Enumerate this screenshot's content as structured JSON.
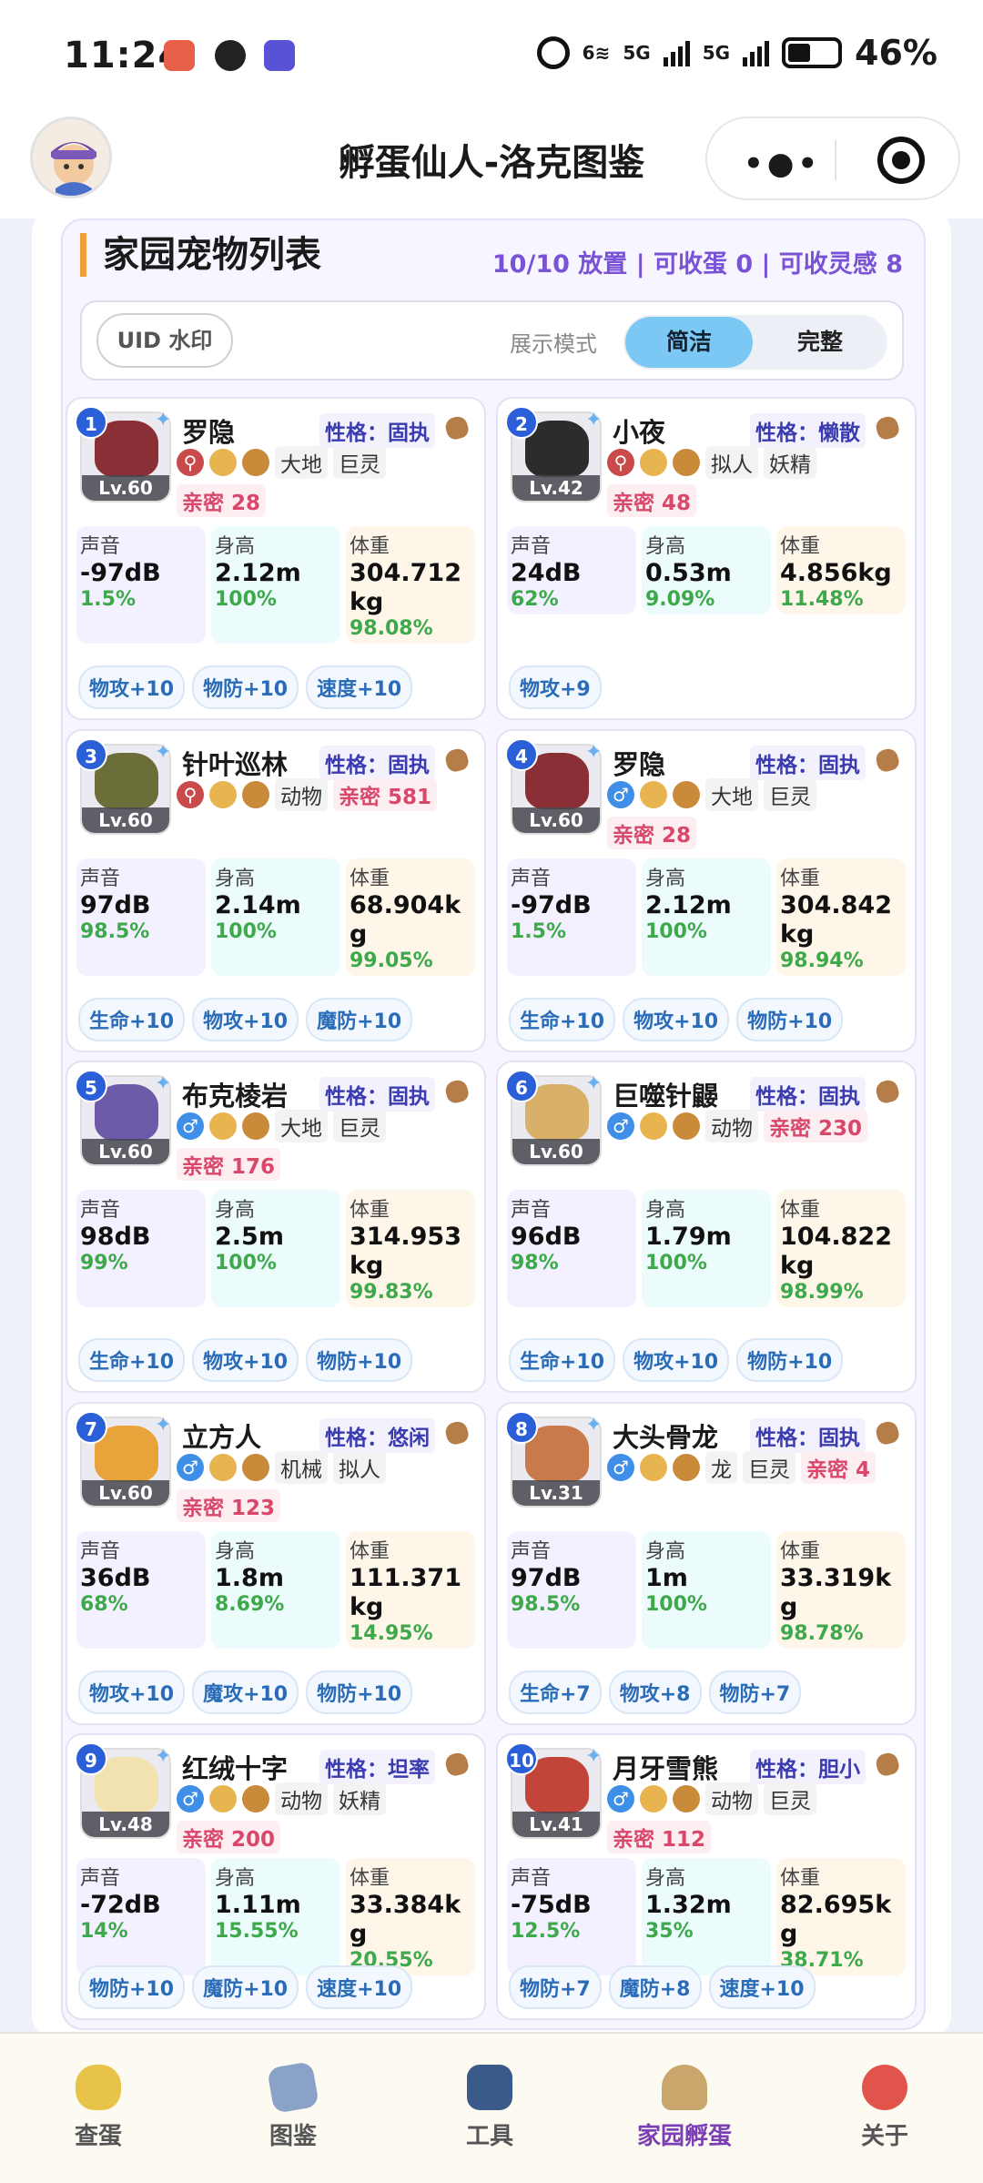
{
  "status_bar": {
    "time": "11:24",
    "network_a": "6",
    "network_b": "5G",
    "network_c": "5G",
    "battery": "46%"
  },
  "header": {
    "title": "孵蛋仙人-洛克图鉴",
    "more_icon": "more-dots-icon",
    "close_icon": "target-icon"
  },
  "section": {
    "title": "家园宠物列表",
    "stats": "10/10 放置 | 可收蛋 0 | 可收灵感 8",
    "uid_button": "UID 水印",
    "mode_label": "展示模式",
    "mode_simple": "简洁",
    "mode_full": "完整"
  },
  "labels": {
    "voice": "声音",
    "height": "身高",
    "weight": "体重"
  },
  "pets": [
    {
      "num": "1",
      "name": "罗隐",
      "level": "Lv.60",
      "nature": "性格：固执",
      "gender": "none",
      "tags": [
        "大地",
        "巨灵"
      ],
      "affinity": "亲密 28",
      "voice": "-97dB",
      "voice_pct": "1.5%",
      "height": "2.12m",
      "height_pct": "100%",
      "weight": "304.712kg",
      "weight_pct": "98.08%",
      "bonuses": [
        "物攻+10",
        "物防+10",
        "速度+10"
      ]
    },
    {
      "num": "2",
      "name": "小夜",
      "level": "Lv.42",
      "nature": "性格：懒散",
      "gender": "none",
      "tags": [
        "拟人",
        "妖精"
      ],
      "affinity": "亲密 48",
      "voice": "24dB",
      "voice_pct": "62%",
      "height": "0.53m",
      "height_pct": "9.09%",
      "weight": "4.856kg",
      "weight_pct": "11.48%",
      "bonuses": [
        "物攻+9"
      ]
    },
    {
      "num": "3",
      "name": "针叶巡林",
      "level": "Lv.60",
      "nature": "性格：固执",
      "gender": "none",
      "tags": [
        "动物"
      ],
      "affinity": "亲密 581",
      "voice": "97dB",
      "voice_pct": "98.5%",
      "height": "2.14m",
      "height_pct": "100%",
      "weight": "68.904kg",
      "weight_pct": "99.05%",
      "bonuses": [
        "生命+10",
        "物攻+10",
        "魔防+10"
      ]
    },
    {
      "num": "4",
      "name": "罗隐",
      "level": "Lv.60",
      "nature": "性格：固执",
      "gender": "male",
      "tags": [
        "大地",
        "巨灵"
      ],
      "affinity": "亲密 28",
      "voice": "-97dB",
      "voice_pct": "1.5%",
      "height": "2.12m",
      "height_pct": "100%",
      "weight": "304.842kg",
      "weight_pct": "98.94%",
      "bonuses": [
        "生命+10",
        "物攻+10",
        "物防+10"
      ]
    },
    {
      "num": "5",
      "name": "布克棱岩",
      "level": "Lv.60",
      "nature": "性格：固执",
      "gender": "male",
      "tags": [
        "大地",
        "巨灵"
      ],
      "affinity": "亲密 176",
      "voice": "98dB",
      "voice_pct": "99%",
      "height": "2.5m",
      "height_pct": "100%",
      "weight": "314.953kg",
      "weight_pct": "99.83%",
      "bonuses": [
        "生命+10",
        "物攻+10",
        "物防+10"
      ]
    },
    {
      "num": "6",
      "name": "巨噬针鼹",
      "level": "Lv.60",
      "nature": "性格：固执",
      "gender": "male",
      "tags": [
        "动物"
      ],
      "affinity": "亲密 230",
      "voice": "96dB",
      "voice_pct": "98%",
      "height": "1.79m",
      "height_pct": "100%",
      "weight": "104.822kg",
      "weight_pct": "98.99%",
      "bonuses": [
        "生命+10",
        "物攻+10",
        "物防+10"
      ]
    },
    {
      "num": "7",
      "name": "立方人",
      "level": "Lv.60",
      "nature": "性格：悠闲",
      "gender": "male",
      "tags": [
        "机械",
        "拟人"
      ],
      "affinity": "亲密 123",
      "voice": "36dB",
      "voice_pct": "68%",
      "height": "1.8m",
      "height_pct": "8.69%",
      "weight": "111.371kg",
      "weight_pct": "14.95%",
      "bonuses": [
        "物攻+10",
        "魔攻+10",
        "物防+10"
      ]
    },
    {
      "num": "8",
      "name": "大头骨龙",
      "level": "Lv.31",
      "nature": "性格：固执",
      "gender": "male",
      "tags": [
        "龙",
        "巨灵"
      ],
      "affinity": "亲密 4",
      "voice": "97dB",
      "voice_pct": "98.5%",
      "height": "1m",
      "height_pct": "100%",
      "weight": "33.319kg",
      "weight_pct": "98.78%",
      "bonuses": [
        "生命+7",
        "物攻+8",
        "物防+7"
      ]
    },
    {
      "num": "9",
      "name": "红绒十字",
      "level": "Lv.48",
      "nature": "性格：坦率",
      "gender": "male",
      "tags": [
        "动物",
        "妖精"
      ],
      "affinity": "亲密 200",
      "voice": "-72dB",
      "voice_pct": "14%",
      "height": "1.11m",
      "height_pct": "15.55%",
      "weight": "33.384kg",
      "weight_pct": "20.55%",
      "bonuses": [
        "物防+10",
        "魔防+10",
        "速度+10"
      ]
    },
    {
      "num": "10",
      "name": "月牙雪熊",
      "level": "Lv.41",
      "nature": "性格：胆小",
      "gender": "male",
      "tags": [
        "动物",
        "巨灵"
      ],
      "affinity": "亲密 112",
      "voice": "-75dB",
      "voice_pct": "12.5%",
      "height": "1.32m",
      "height_pct": "35%",
      "weight": "82.695kg",
      "weight_pct": "38.71%",
      "bonuses": [
        "物防+7",
        "魔防+8",
        "速度+10"
      ]
    }
  ],
  "tabbar": [
    {
      "label": "查蛋",
      "icon": "egg-icon"
    },
    {
      "label": "图鉴",
      "icon": "card-icon"
    },
    {
      "label": "工具",
      "icon": "tools-icon"
    },
    {
      "label": "家园孵蛋",
      "icon": "nest-icon",
      "active": true
    },
    {
      "label": "关于",
      "icon": "heart-icon"
    }
  ]
}
